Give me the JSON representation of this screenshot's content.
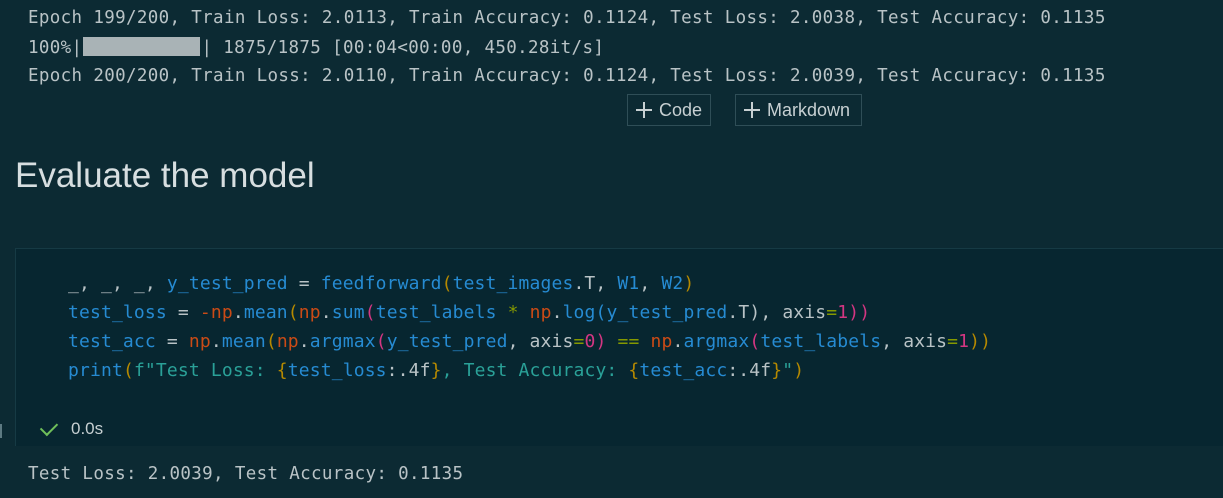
{
  "output_top": {
    "line1": "Epoch 199/200, Train Loss: 2.0113, Train Accuracy: 0.1124, Test Loss: 2.0038, Test Accuracy: 0.1135",
    "progress_pct": "100%|",
    "progress_fraction": 1.0,
    "progress_rest": "| 1875/1875 [00:04<00:00, 450.28it/s]",
    "line3": "Epoch 200/200, Train Loss: 2.0110, Train Accuracy: 0.1124, Test Loss: 2.0039, Test Accuracy: 0.1135"
  },
  "toolbar": {
    "code_label": "Code",
    "markdown_label": "Markdown"
  },
  "markdown": {
    "heading": "Evaluate the model"
  },
  "cell": {
    "status_time": "0.0s",
    "output": "Test Loss: 2.0039, Test Accuracy: 0.1135",
    "code_tokens": {
      "l1": [
        "_, _, _, ",
        "y_test_pred",
        " = ",
        "feedforward",
        "(",
        "test_images",
        ".T, ",
        "W1",
        ", ",
        "W2",
        ")"
      ],
      "l2": [
        "test_loss",
        " = ",
        "-",
        "np",
        ".",
        "mean",
        "(",
        "np",
        ".",
        "sum",
        "(",
        "test_labels",
        " * ",
        "np",
        ".",
        "log",
        "(",
        "y_test_pred",
        ".T), axis",
        "=",
        "1",
        "))"
      ],
      "l3": [
        "test_acc",
        " = ",
        "np",
        ".",
        "mean",
        "(",
        "np",
        ".",
        "argmax",
        "(",
        "y_test_pred",
        ", axis",
        "=",
        "0",
        ") ",
        "==",
        " ",
        "np",
        ".",
        "argmax",
        "(",
        "test_labels",
        ", axis",
        "=",
        "1",
        "))"
      ],
      "l4": [
        "print",
        "(",
        "f\"Test Loss: ",
        "{",
        "test_loss",
        ":.4f",
        "}",
        ", Test Accuracy: ",
        "{",
        "test_acc",
        ":.4f",
        "}",
        "\"",
        ")"
      ]
    }
  },
  "colors": {
    "background": "#0c2a33",
    "cell_background": "#072630",
    "check": "#6fbf5a"
  },
  "icons": [
    "plus-icon",
    "check-icon"
  ]
}
